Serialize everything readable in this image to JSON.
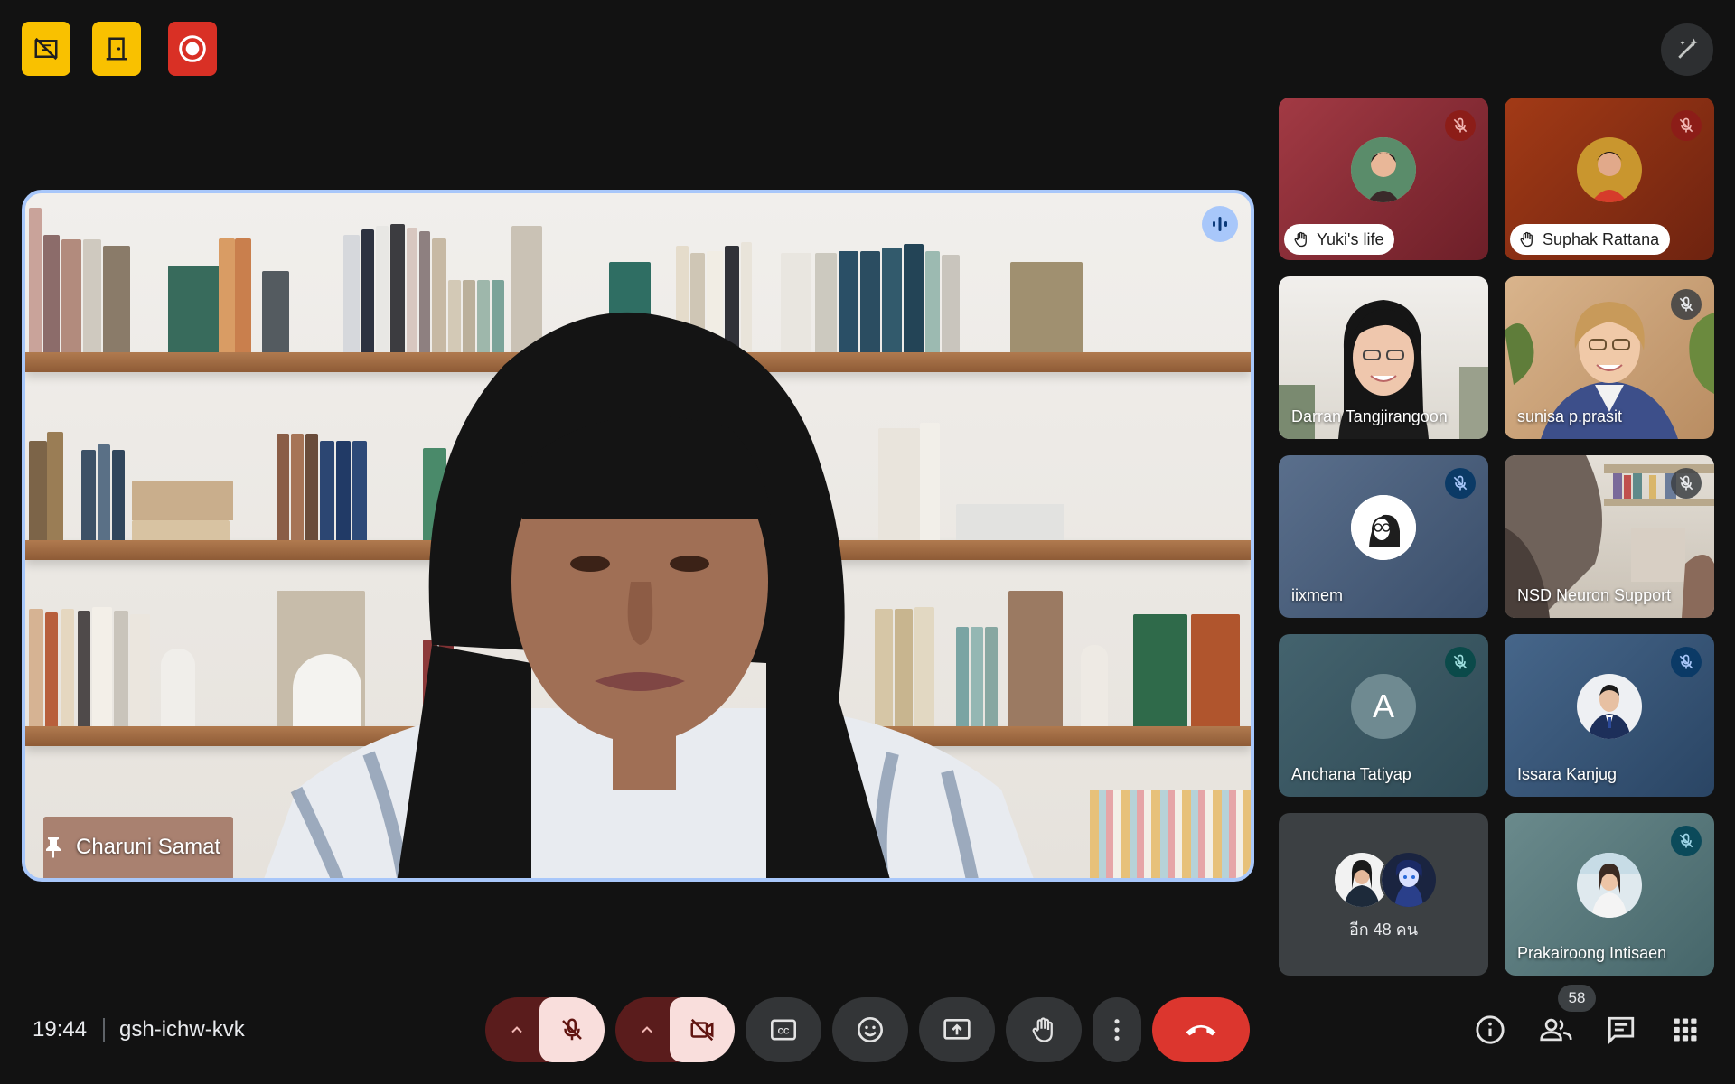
{
  "meeting": {
    "time": "19:44",
    "code": "gsh-ichw-kvk",
    "participant_count": "58"
  },
  "main_speaker": {
    "name": "Charuni Samat"
  },
  "tiles": [
    {
      "name": "Yuki's life",
      "hand_raised": true,
      "muted": true,
      "color": "#8b2c33"
    },
    {
      "name": "Suphak Rattana",
      "hand_raised": true,
      "muted": true,
      "color": "#8b2a14"
    },
    {
      "name": "Darran Tangjirangoon",
      "hand_raised": false,
      "muted": false,
      "color": "#e9e6e1"
    },
    {
      "name": "sunisa p.prasit",
      "hand_raised": false,
      "muted": true,
      "color": "#c8a27c"
    },
    {
      "name": "iixmem",
      "hand_raised": false,
      "muted": true,
      "color": "#4d6382"
    },
    {
      "name": "NSD Neuron Support",
      "hand_raised": false,
      "muted": true,
      "color": "#d8d2c9"
    },
    {
      "name": "Anchana Tatiyap",
      "hand_raised": false,
      "muted": true,
      "color": "#3f5a66",
      "initial": "A"
    },
    {
      "name": "Issara Kanjug",
      "hand_raised": false,
      "muted": true,
      "color": "#3c5876"
    },
    {
      "name": "อีก 48 คน",
      "hand_raised": false,
      "muted": false,
      "color": "#3c4043"
    },
    {
      "name": "Prakairoong Intisaen",
      "hand_raised": false,
      "muted": true,
      "color": "#5c7a80"
    }
  ]
}
